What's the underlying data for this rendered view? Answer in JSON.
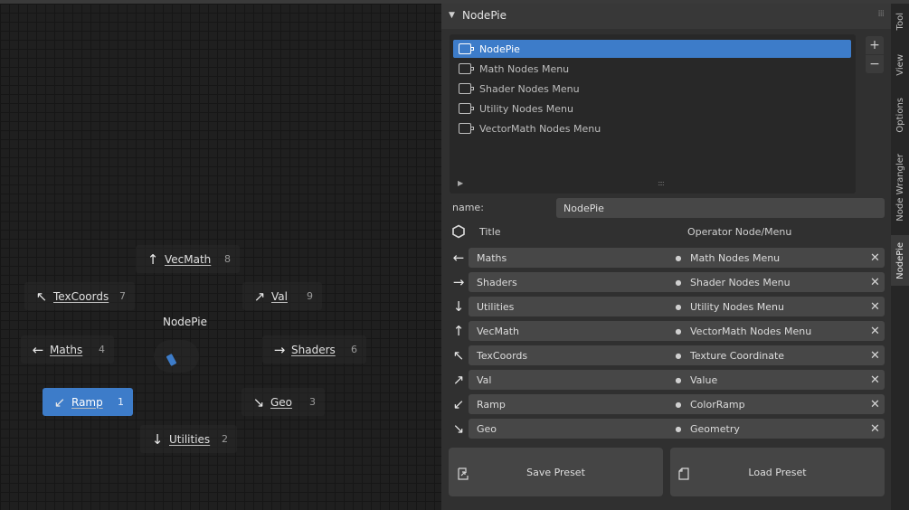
{
  "pie_menu": {
    "title": "NodePie",
    "items": [
      {
        "label": "VecMath",
        "number": "8",
        "arrow": "↑"
      },
      {
        "label": "TexCoords",
        "number": "7",
        "arrow": "↖"
      },
      {
        "label": "Val",
        "number": "9",
        "arrow": "↗"
      },
      {
        "label": "Maths",
        "number": "4",
        "arrow": "←"
      },
      {
        "label": "Shaders",
        "number": "6",
        "arrow": "→"
      },
      {
        "label": "Ramp",
        "number": "1",
        "arrow": "↙"
      },
      {
        "label": "Geo",
        "number": "3",
        "arrow": "↘"
      },
      {
        "label": "Utilities",
        "number": "2",
        "arrow": "↓"
      }
    ],
    "active_color": "#3d7cc9"
  },
  "panel": {
    "title": "NodePie",
    "list": [
      {
        "label": "NodePie"
      },
      {
        "label": "Math Nodes Menu"
      },
      {
        "label": "Shader Nodes Menu"
      },
      {
        "label": "Utility Nodes Menu"
      },
      {
        "label": "VectorMath Nodes Menu"
      }
    ],
    "add_symbol": "+",
    "remove_symbol": "−",
    "name_label": "name:",
    "name_value": "NodePie",
    "col_title": "Title",
    "col_operator": "Operator Node/Menu",
    "rows": [
      {
        "arrow": "←",
        "title": "Maths",
        "operator": "Math Nodes Menu"
      },
      {
        "arrow": "→",
        "title": "Shaders",
        "operator": "Shader Nodes Menu"
      },
      {
        "arrow": "↓",
        "title": "Utilities",
        "operator": "Utility Nodes Menu"
      },
      {
        "arrow": "↑",
        "title": "VecMath",
        "operator": "VectorMath Nodes Menu"
      },
      {
        "arrow": "↖",
        "title": "TexCoords",
        "operator": "Texture Coordinate"
      },
      {
        "arrow": "↗",
        "title": "Val",
        "operator": "Value"
      },
      {
        "arrow": "↙",
        "title": "Ramp",
        "operator": "ColorRamp"
      },
      {
        "arrow": "↘",
        "title": "Geo",
        "operator": "Geometry"
      }
    ],
    "dot": "●",
    "remove_x": "✕",
    "save_label": "Save Preset",
    "load_label": "Load Preset"
  },
  "tabs": [
    {
      "label": "Tool"
    },
    {
      "label": "View"
    },
    {
      "label": "Options"
    },
    {
      "label": "Node Wrangler"
    },
    {
      "label": "NodePie"
    }
  ]
}
